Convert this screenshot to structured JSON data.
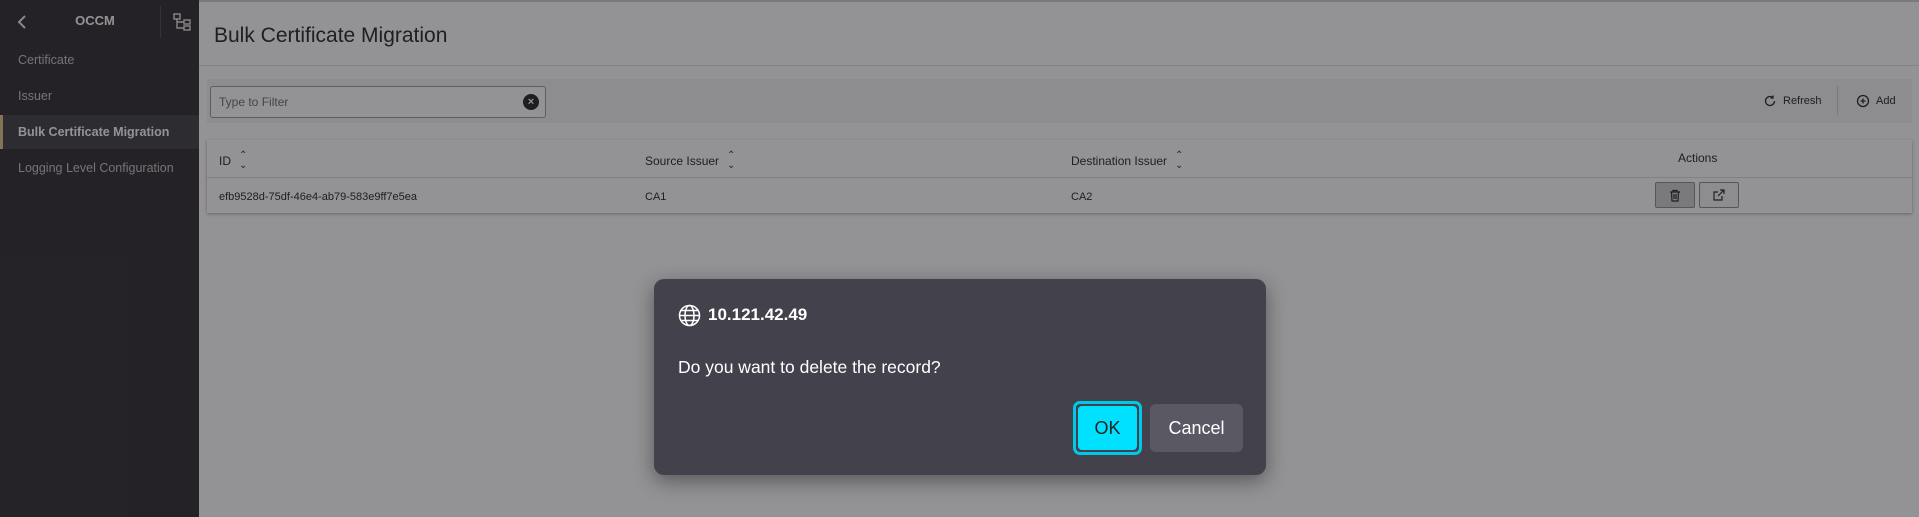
{
  "sidebar": {
    "title": "OCCM",
    "items": [
      {
        "label": "Certificate"
      },
      {
        "label": "Issuer"
      },
      {
        "label": "Bulk Certificate Migration"
      },
      {
        "label": "Logging Level Configuration"
      }
    ],
    "active_index": 2
  },
  "main": {
    "title": "Bulk Certificate Migration",
    "filter": {
      "placeholder": "Type to Filter",
      "value": ""
    },
    "toolbar": {
      "refresh_label": "Refresh",
      "add_label": "Add"
    },
    "table": {
      "columns": [
        "ID",
        "Source Issuer",
        "Destination Issuer",
        "Actions"
      ],
      "rows": [
        {
          "id": "efb9528d-75df-46e4-ab79-583e9ff7e5ea",
          "source": "CA1",
          "destination": "CA2"
        }
      ]
    }
  },
  "dialog": {
    "host": "10.121.42.49",
    "message": "Do you want to delete the record?",
    "ok_label": "OK",
    "cancel_label": "Cancel"
  },
  "colors": {
    "sidebar_bg": "#2b2a2d",
    "active_accent": "#e0c38c",
    "dialog_bg": "#43414b",
    "ok_bg": "#00e1ff",
    "ok_border": "#00c8e8"
  },
  "icons": [
    "back-chevron-icon",
    "tree-structure-icon",
    "clear-icon",
    "refresh-icon",
    "add-circle-icon",
    "sort-icon",
    "trash-icon",
    "external-link-icon",
    "globe-icon"
  ]
}
